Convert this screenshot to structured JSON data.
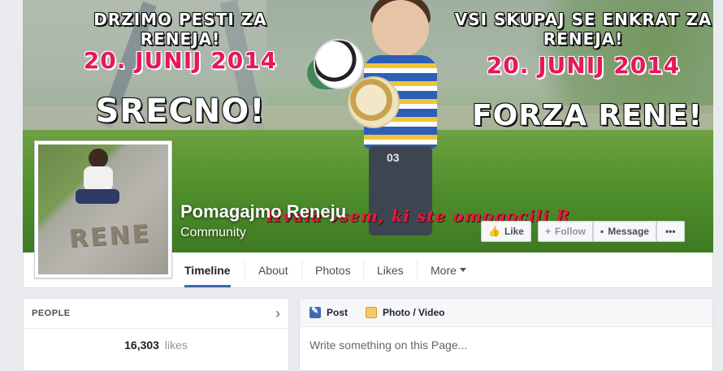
{
  "cover": {
    "left_line1": "DRZIMO PESTI ZA RENEJA!",
    "left_line2": "20. JUNIJ 2014",
    "left_line3": "SRECNO!",
    "right_line1": "VSI SKUPAJ SE ENKRAT ZA RENEJA!",
    "right_line2": "20. JUNIJ 2014",
    "right_line3": "FORZA RENE!",
    "script_text": "Hvala vsem, ki ste omogocili R",
    "shirt_number": "03"
  },
  "page": {
    "name": "Pomagajmo Reneju",
    "category": "Community"
  },
  "profile": {
    "written_word": "RENE"
  },
  "actions": {
    "like_label": "Like",
    "follow_label": "Follow",
    "message_label": "Message",
    "more_label": "•••"
  },
  "nav": {
    "tabs": [
      {
        "label": "Timeline"
      },
      {
        "label": "About"
      },
      {
        "label": "Photos"
      },
      {
        "label": "Likes"
      },
      {
        "label": "More"
      }
    ]
  },
  "people": {
    "title": "PEOPLE",
    "count": "16,303",
    "count_label": "likes"
  },
  "composer": {
    "post_label": "Post",
    "photo_label": "Photo / Video",
    "placeholder": "Write something on this Page..."
  },
  "colors": {
    "accent": "#4267b2",
    "cover_pink": "#e6175b",
    "script_red": "#e21c3e"
  }
}
